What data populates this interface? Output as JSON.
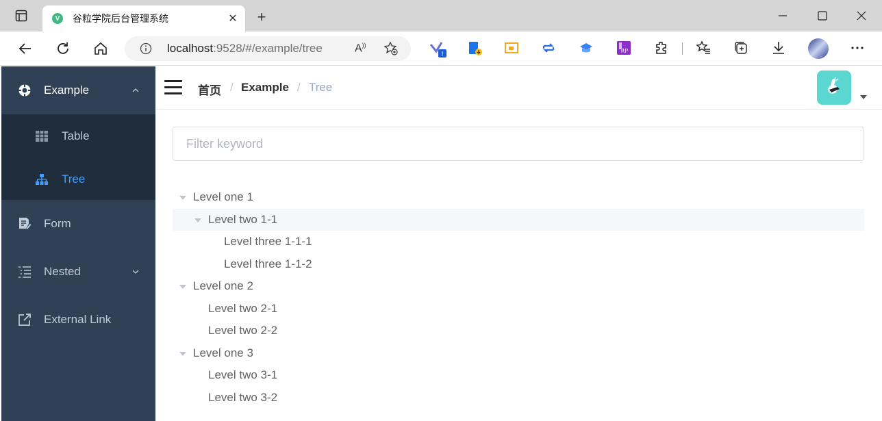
{
  "browser": {
    "tab_title": "谷粒学院后台管理系统",
    "favicon_letter": "V",
    "url_host": "localhost",
    "url_rest": ":9528/#/example/tree"
  },
  "sidebar": {
    "items": [
      {
        "label": "Example",
        "icon": "example-icon",
        "expanded": true
      },
      {
        "label": "Table",
        "icon": "table-icon",
        "sub": true
      },
      {
        "label": "Tree",
        "icon": "tree-icon",
        "sub": true,
        "active": true
      },
      {
        "label": "Form",
        "icon": "form-icon"
      },
      {
        "label": "Nested",
        "icon": "nested-icon",
        "collapsible": true
      },
      {
        "label": "External Link",
        "icon": "external-link-icon"
      }
    ]
  },
  "breadcrumb": {
    "home": "首页",
    "sep": "/",
    "section": "Example",
    "current": "Tree"
  },
  "filter": {
    "placeholder": "Filter keyword"
  },
  "tree": [
    {
      "label": "Level one 1",
      "level": 1,
      "expandable": true
    },
    {
      "label": "Level two 1-1",
      "level": 2,
      "expandable": true,
      "highlighted": true
    },
    {
      "label": "Level three 1-1-1",
      "level": 3
    },
    {
      "label": "Level three 1-1-2",
      "level": 3
    },
    {
      "label": "Level one 2",
      "level": 1,
      "expandable": true
    },
    {
      "label": "Level two 2-1",
      "level": 2
    },
    {
      "label": "Level two 2-2",
      "level": 2
    },
    {
      "label": "Level one 3",
      "level": 1,
      "expandable": true
    },
    {
      "label": "Level two 3-1",
      "level": 2
    },
    {
      "label": "Level two 3-2",
      "level": 2
    }
  ],
  "colors": {
    "sidebar_bg": "#304156",
    "sidebar_sub_bg": "#1f2d3d",
    "sidebar_text": "#bfcbd9",
    "active": "#409eff",
    "avatar_bg": "#5bd6d0"
  }
}
